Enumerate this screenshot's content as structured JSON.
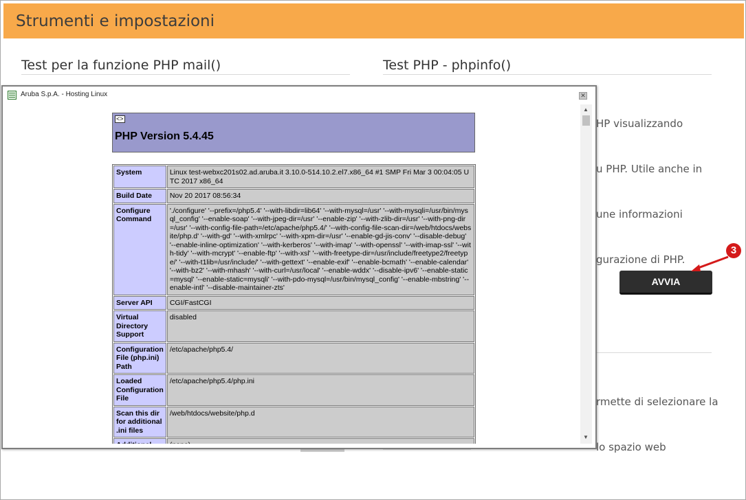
{
  "header": {
    "title": "Strumenti e impostazioni"
  },
  "sections": {
    "mail_test": {
      "title": "Test per la funzione PHP mail()"
    },
    "phpinfo": {
      "title": "Test PHP - phpinfo()",
      "description_lines": [
        "HP visualizzando",
        "u PHP. Utile anche in",
        "une informazioni",
        "gurazione di PHP."
      ],
      "button_label": "AVVIA",
      "step_badge": "3"
    },
    "version_select": {
      "description_lines": [
        "rmette di selezionare la",
        "lo spazio web"
      ]
    }
  },
  "popup": {
    "window_title": "Aruba S.p.A. - Hosting Linux",
    "close_label": "✕",
    "php_logo_text": "<>",
    "php_version": "PHP Version 5.4.45",
    "rows": [
      {
        "key": "System",
        "value": "Linux test-webxc201s02.ad.aruba.it 3.10.0-514.10.2.el7.x86_64 #1 SMP Fri Mar 3 00:04:05 UTC 2017 x86_64"
      },
      {
        "key": "Build Date",
        "value": "Nov 20 2017 08:56:34"
      },
      {
        "key": "Configure Command",
        "value": "'./configure' '--prefix=/php5.4' '--with-libdir=lib64' '--with-mysql=/usr' '--with-mysqli=/usr/bin/mysql_config' '--enable-soap' '--with-jpeg-dir=/usr' '--enable-zip' '--with-zlib-dir=/usr' '--with-png-dir=/usr' '--with-config-file-path=/etc/apache/php5.4/' '--with-config-file-scan-dir=/web/htdocs/website/php.d' '--with-gd' '--with-xmlrpc' '--with-xpm-dir=/usr' '--enable-gd-jis-conv' '--disable-debug' '--enable-inline-optimization' '--with-kerberos' '--with-imap' '--with-openssl' '--with-imap-ssl' '--with-tidy' '--with-mcrypt' '--enable-ftp' '--with-xsl' '--with-freetype-dir=/usr/include/freetype2/freetype/' '--with-t1lib=/usr/include/' '--with-gettext' '--enable-exif' '--enable-bcmath' '--enable-calendar' '--with-bz2' '--with-mhash' '--with-curl=/usr/local' '--enable-wddx' '--disable-ipv6' '--enable-static=mysql' '--enable-static=mysqli' '--with-pdo-mysql=/usr/bin/mysql_config' '--enable-mbstring' '--enable-intl' '--disable-maintainer-zts'"
      },
      {
        "key": "Server API",
        "value": "CGI/FastCGI"
      },
      {
        "key": "Virtual Directory Support",
        "value": "disabled"
      },
      {
        "key": "Configuration File (php.ini) Path",
        "value": "/etc/apache/php5.4/"
      },
      {
        "key": "Loaded Configuration File",
        "value": "/etc/apache/php5.4/php.ini"
      },
      {
        "key": "Scan this dir for additional .ini files",
        "value": "/web/htdocs/website/php.d"
      },
      {
        "key": "Additional .ini files parsed",
        "value": "(none)"
      }
    ]
  },
  "colors": {
    "header_bar": "#f8a94a",
    "button": "#2e2e2e",
    "badge": "#d41a1a",
    "php_header": "#9999cc",
    "php_key": "#ccccff",
    "php_value": "#cccccc"
  }
}
